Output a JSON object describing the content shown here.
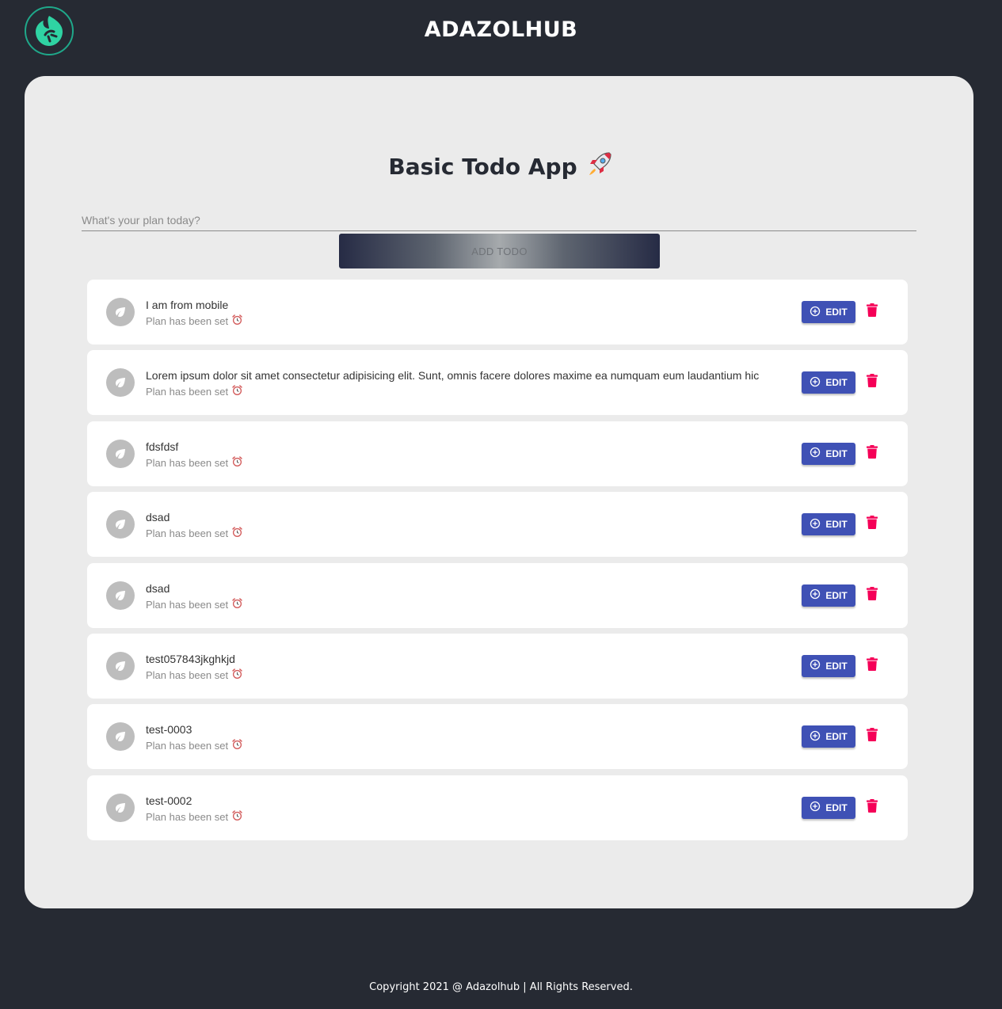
{
  "header": {
    "brand": "ADAZOLHUB",
    "logo_icon": "leaf-logo-icon",
    "logo_color": "#2fd3a3"
  },
  "main": {
    "title": "Basic Todo App",
    "title_icon": "rocket-icon",
    "input_placeholder": "What's your plan today?",
    "input_value": "",
    "add_button_label": "ADD TODO"
  },
  "todos": [
    {
      "title": "I am from mobile",
      "subtitle": "Plan has been set",
      "edit_label": "EDIT"
    },
    {
      "title": "Lorem ipsum dolor sit amet consectetur adipisicing elit. Sunt, omnis facere dolores maxime ea numquam eum laudantium hic",
      "subtitle": "Plan has been set",
      "edit_label": "EDIT"
    },
    {
      "title": "fdsfdsf",
      "subtitle": "Plan has been set",
      "edit_label": "EDIT"
    },
    {
      "title": "dsad",
      "subtitle": "Plan has been set",
      "edit_label": "EDIT"
    },
    {
      "title": "dsad",
      "subtitle": "Plan has been set",
      "edit_label": "EDIT"
    },
    {
      "title": "test057843jkghkjd",
      "subtitle": "Plan has been set",
      "edit_label": "EDIT"
    },
    {
      "title": "test-0003",
      "subtitle": "Plan has been set",
      "edit_label": "EDIT"
    },
    {
      "title": "test-0002",
      "subtitle": "Plan has been set",
      "edit_label": "EDIT"
    }
  ],
  "icons": {
    "todo_avatar": "eco-leaf-icon",
    "todo_sub": "alarm-clock-icon",
    "edit": "add-circle-outline-icon",
    "delete": "trash-icon"
  },
  "colors": {
    "page_bg": "#262a33",
    "card_bg": "#ebebeb",
    "edit_button": "#3f51b5",
    "delete_icon": "#f50057"
  },
  "footer": {
    "text": "Copyright 2021 @ Adazolhub | All Rights Reserved."
  }
}
